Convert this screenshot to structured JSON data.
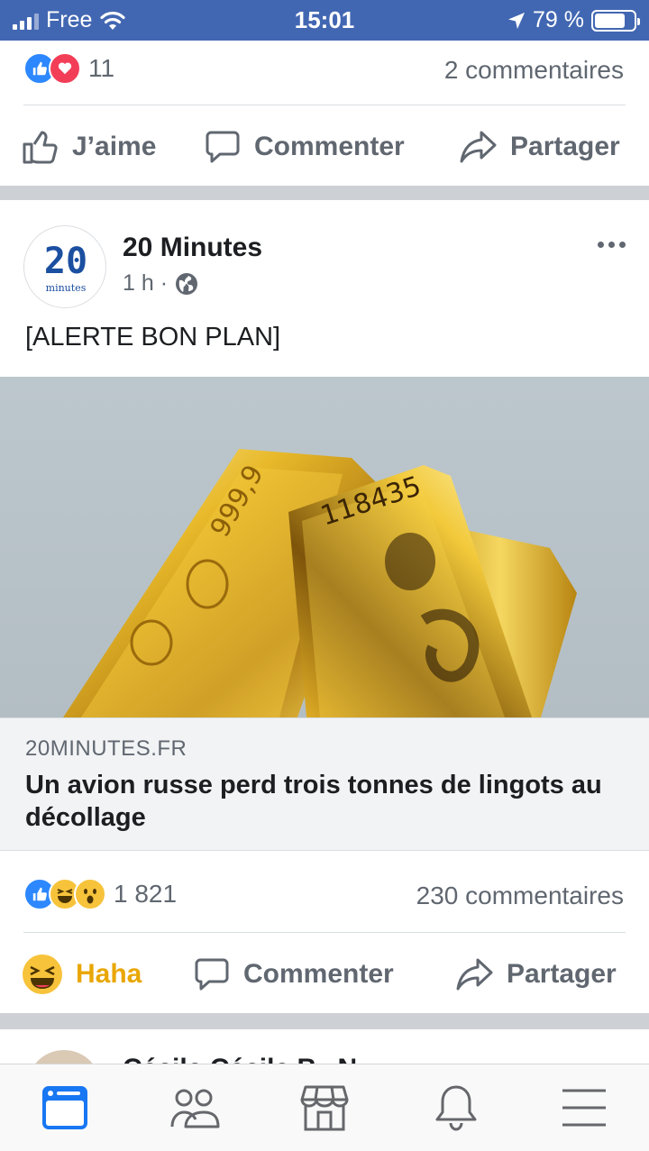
{
  "status_bar": {
    "carrier": "Free",
    "time": "15:01",
    "battery": "79 %",
    "battery_level": 0.79
  },
  "previous_post": {
    "reaction_count": "11",
    "comments": "2 commentaires",
    "actions": {
      "like": "J’aime",
      "comment": "Commenter",
      "share": "Partager"
    }
  },
  "post": {
    "page_name": "20 Minutes",
    "avatar_text": "20",
    "avatar_subtext": "minutes",
    "time": "1 h ·",
    "text": "[ALERTE BON PLAN]",
    "link": {
      "domain": "20MINUTES.FR",
      "title": "Un avion russe perd trois tonnes de lingots au décollage"
    },
    "reaction_count": "1 821",
    "comments": "230 commentaires",
    "actions": {
      "reaction": "Haha",
      "comment": "Commenter",
      "share": "Partager"
    }
  },
  "next_post": {
    "name": "Cécile Cécile B▸ N..."
  },
  "colors": {
    "brand": "#4267b2",
    "like": "#2d88ff",
    "love": "#f33e58",
    "haha": "#f7c33b",
    "tab_active": "#1877f2",
    "tab_inactive": "#65676b"
  },
  "tabs": [
    "news-feed-icon",
    "friends-icon",
    "marketplace-icon",
    "notifications-icon",
    "menu-icon"
  ]
}
